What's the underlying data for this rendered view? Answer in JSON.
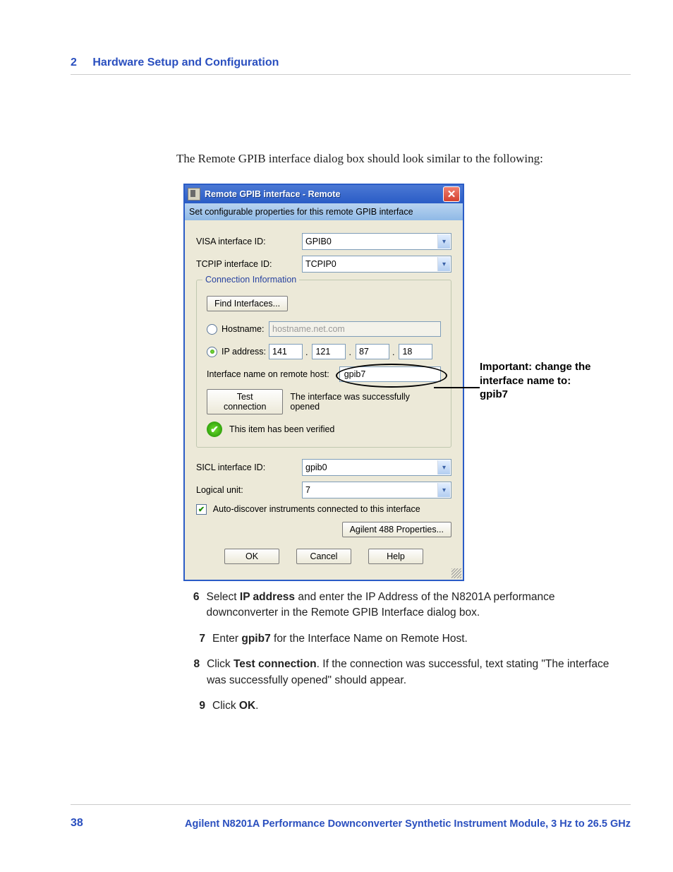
{
  "header": {
    "chapter_num": "2",
    "chapter_title": "Hardware Setup and Configuration"
  },
  "intro_text": "The Remote GPIB interface dialog box should look similar to the following:",
  "dialog": {
    "title": "Remote GPIB interface - Remote",
    "subheader": "Set configurable properties for this remote GPIB interface",
    "visa_label": "VISA interface ID:",
    "visa_value": "GPIB0",
    "tcpip_label": "TCPIP interface ID:",
    "tcpip_value": "TCPIP0",
    "conn_group": "Connection Information",
    "find_btn": "Find Interfaces...",
    "hostname_label": "Hostname:",
    "hostname_placeholder": "hostname.net.com",
    "ip_label": "IP address:",
    "ip": {
      "a": "141",
      "b": "121",
      "c": "87",
      "d": "18"
    },
    "ifname_label": "Interface name on remote host:",
    "ifname_value": "gpib7",
    "test_btn": "Test connection",
    "test_result": "The interface was successfully opened",
    "verified_text": "This item has been verified",
    "sicl_label": "SICL interface ID:",
    "sicl_value": "gpib0",
    "lu_label": "Logical unit:",
    "lu_value": "7",
    "autodisc_label": "Auto-discover instruments connected to this interface",
    "agilent_btn": "Agilent 488 Properties...",
    "ok_btn": "OK",
    "cancel_btn": "Cancel",
    "help_btn": "Help"
  },
  "callout": {
    "line1": "Important: change the",
    "line2": "interface name to:",
    "line3": "gpib7"
  },
  "steps": {
    "s6": {
      "n": "6",
      "pre": "Select ",
      "b": "IP address",
      "post": " and enter the IP Address of the N8201A performance downconverter in the Remote GPIB Interface dialog box."
    },
    "s7": {
      "n": "7",
      "pre": "Enter ",
      "b": "gpib7",
      "post": " for the Interface Name on Remote Host."
    },
    "s8": {
      "n": "8",
      "pre": "Click ",
      "b": "Test connection",
      "post": ". If the connection was successful, text stating \"The interface was successfully opened\" should appear."
    },
    "s9": {
      "n": "9",
      "pre": "Click ",
      "b": "OK",
      "post": "."
    }
  },
  "footer": {
    "page": "38",
    "title": "Agilent N8201A Performance Downconverter Synthetic Instrument Module, 3 Hz to 26.5 GHz"
  }
}
